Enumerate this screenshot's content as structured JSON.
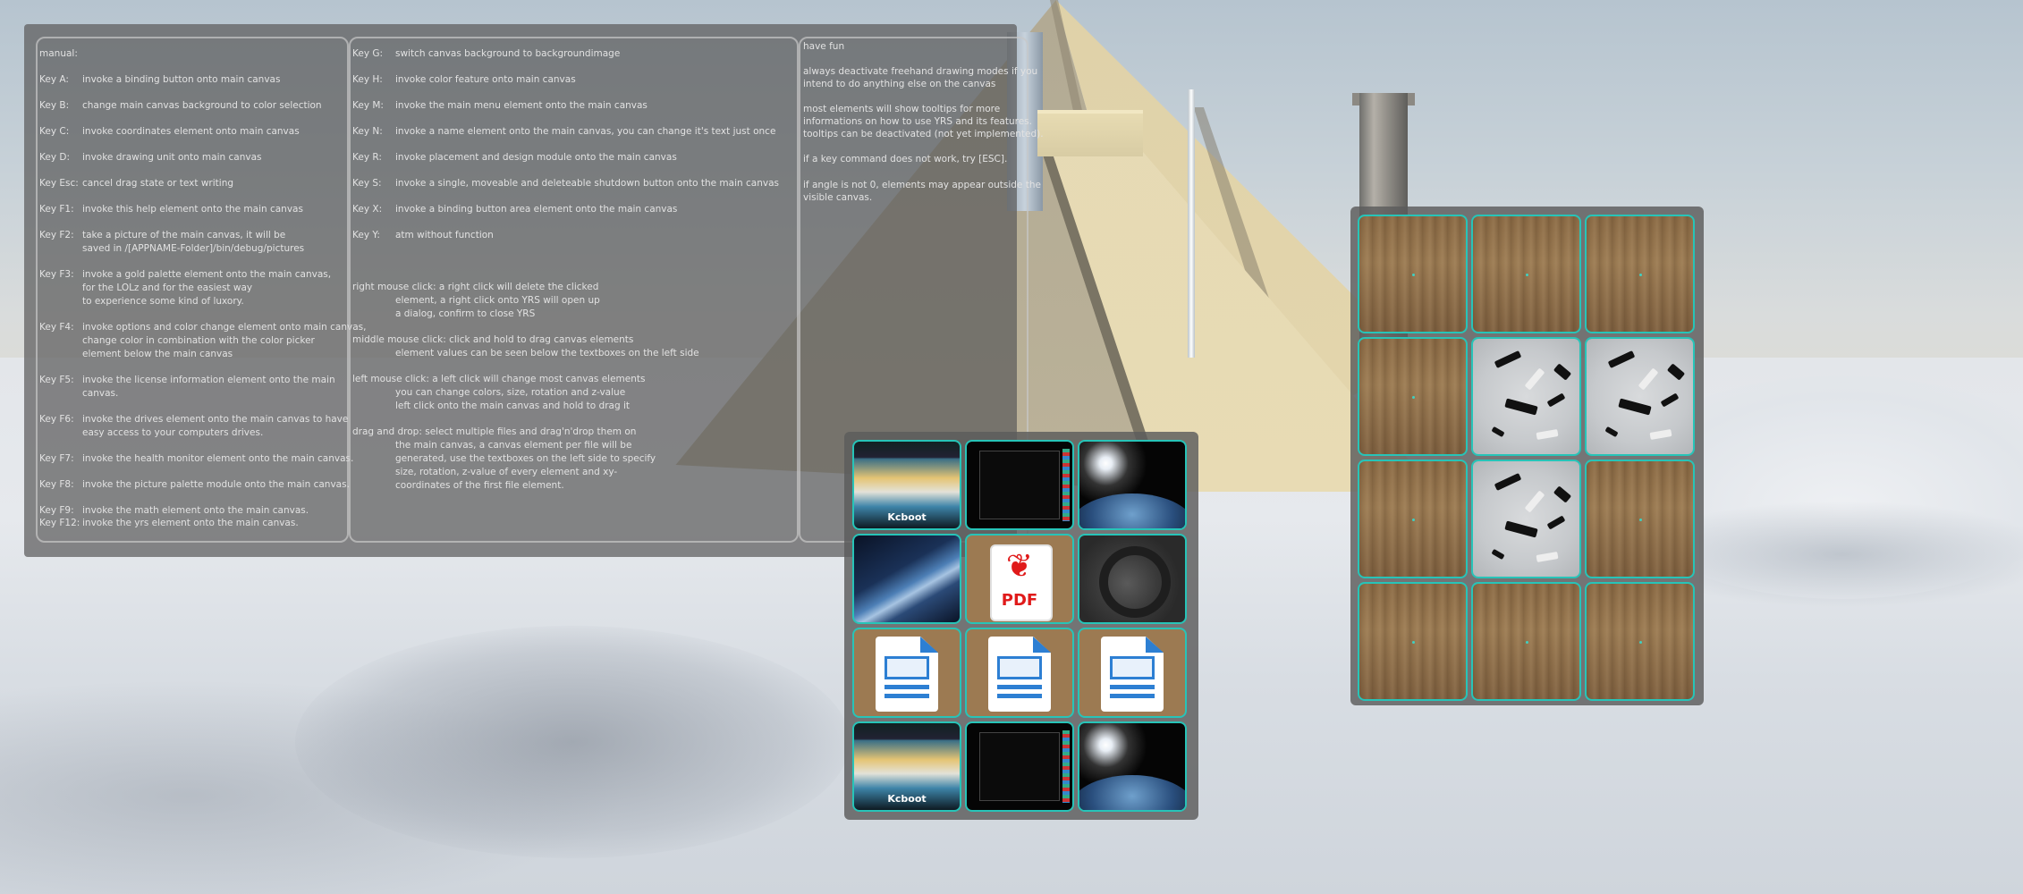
{
  "manual": {
    "col1": [
      {
        "key": "manual:",
        "text": ""
      },
      {
        "key": "Key A:",
        "text": "invoke a binding button onto main canvas"
      },
      {
        "key": "Key B:",
        "text": "change main canvas background to color selection"
      },
      {
        "key": "Key C:",
        "text": "invoke coordinates element onto main canvas"
      },
      {
        "key": "Key D:",
        "text": "invoke drawing unit onto main canvas"
      },
      {
        "key": "Key Esc:",
        "text": "cancel drag state or text writing"
      },
      {
        "key": "Key F1:",
        "text": "invoke this help element onto the main canvas"
      },
      {
        "key": "Key F2:",
        "text": "take a picture of the main canvas, it will be"
      },
      {
        "key": "",
        "text": "saved in /[APPNAME-Folder]/bin/debug/pictures"
      },
      {
        "key": "Key F3:",
        "text": "invoke a gold palette element onto the main canvas,"
      },
      {
        "key": "",
        "text": "for the LOLz and for the easiest way"
      },
      {
        "key": "",
        "text": "to experience some kind of luxory."
      },
      {
        "key": "Key F4:",
        "text": "invoke options and color change element onto main canvas,"
      },
      {
        "key": "",
        "text": "change color in combination with the color picker"
      },
      {
        "key": "",
        "text": "element below the main canvas"
      },
      {
        "key": "Key F5:",
        "text": "invoke the license information element onto the main"
      },
      {
        "key": "",
        "text": "canvas."
      },
      {
        "key": "Key F6:",
        "text": "invoke the drives element onto the main canvas to have"
      },
      {
        "key": "",
        "text": "easy access to your computers drives."
      },
      {
        "key": "Key F7:",
        "text": "invoke the health monitor element onto the main canvas."
      },
      {
        "key": "Key F8:",
        "text": "invoke the picture palette module onto the main canvas."
      },
      {
        "key": "Key F9:",
        "text": "invoke the math element onto the main canvas."
      },
      {
        "key": "Key F12:",
        "text": "invoke the yrs element onto the main canvas."
      }
    ],
    "col2": [
      {
        "key": "Key G:",
        "text": "switch canvas background to backgroundimage"
      },
      {
        "key": "Key H:",
        "text": "invoke color feature onto main canvas"
      },
      {
        "key": "Key M:",
        "text": "invoke the main menu element onto the main canvas"
      },
      {
        "key": "Key N:",
        "text": "invoke a name element onto the main canvas, you can change          it's text just once"
      },
      {
        "key": "Key R:",
        "text": "invoke placement and design module onto the main canvas"
      },
      {
        "key": "Key S:",
        "text": "invoke a single, moveable and deleteable shutdown button onto the main canvas"
      },
      {
        "key": "Key X:",
        "text": "invoke a binding button area element onto the main canvas"
      },
      {
        "key": "Key Y:",
        "text": "atm without function"
      },
      {
        "key": "",
        "text": "right mouse click: a right click will delete the clicked"
      },
      {
        "key": "",
        "text": "element, a right click onto YRS will open up"
      },
      {
        "key": "",
        "text": "a dialog, confirm to close YRS"
      },
      {
        "key": "",
        "text": "middle mouse click: click and hold to drag canvas elements"
      },
      {
        "key": "",
        "text": "element values can be seen below the textboxes on the left side"
      },
      {
        "key": "",
        "text": "left mouse click: a left click will change most canvas elements"
      },
      {
        "key": "",
        "text": "you can change colors, size, rotation and z-value"
      },
      {
        "key": "",
        "text": "left click onto the main canvas and hold to drag it"
      },
      {
        "key": "",
        "text": "drag and drop: select multiple files and drag'n'drop them on"
      },
      {
        "key": "",
        "text": "the main canvas, a canvas element per file will be"
      },
      {
        "key": "",
        "text": "generated, use the textboxes on the left side to specify"
      },
      {
        "key": "",
        "text": "size, rotation, z-value of every element and xy-"
      },
      {
        "key": "",
        "text": "coordinates of the first file element."
      }
    ],
    "col3": [
      "have fun",
      "always deactivate freehand drawing modes if you",
      "intend to do anything else on the canvas",
      "most elements will show tooltips for more",
      "informations on how to use YRS and its features.",
      "tooltips can be deactivated (not yet implemented).",
      "if a key command does not work, try [ESC].",
      "if angle is not 0, elements may appear outside the",
      "visible canvas."
    ]
  },
  "palette_a": {
    "tiles": [
      {
        "kind": "kcboot",
        "label": "Kcboot"
      },
      {
        "kind": "screen"
      },
      {
        "kind": "space"
      },
      {
        "kind": "planet"
      },
      {
        "kind": "pdf",
        "label": "PDF"
      },
      {
        "kind": "dark"
      },
      {
        "kind": "odt"
      },
      {
        "kind": "odt"
      },
      {
        "kind": "odt"
      },
      {
        "kind": "kcboot",
        "label": "Kcboot"
      },
      {
        "kind": "screen"
      },
      {
        "kind": "space"
      }
    ]
  },
  "palette_b": {
    "tiles": [
      {
        "kind": "wood"
      },
      {
        "kind": "wood"
      },
      {
        "kind": "wood"
      },
      {
        "kind": "wood"
      },
      {
        "kind": "debris"
      },
      {
        "kind": "debris"
      },
      {
        "kind": "wood"
      },
      {
        "kind": "debris"
      },
      {
        "kind": "wood"
      },
      {
        "kind": "wood"
      },
      {
        "kind": "wood"
      },
      {
        "kind": "wood"
      }
    ]
  },
  "colors": {
    "tile_border": "#27c4b8",
    "panel_bg": "#5c5c5c",
    "manual_text": "#e2e2e2"
  }
}
